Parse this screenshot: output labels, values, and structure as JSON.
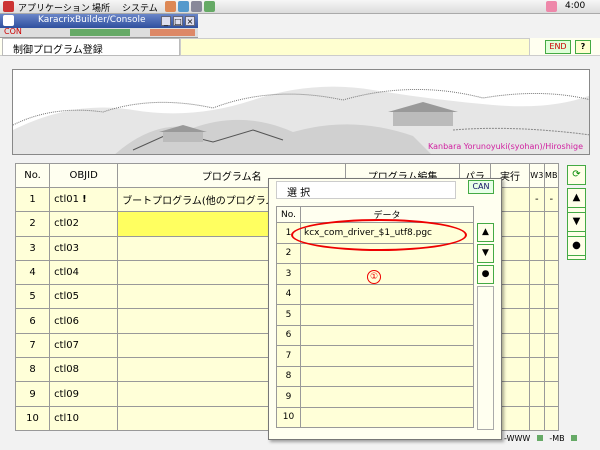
{
  "system_bar": {
    "menu_apps": "アプリケーション",
    "menu_places": "場所",
    "menu_system": "システム",
    "clock": "4:00"
  },
  "window": {
    "title": "KaracrixBuilder/Console",
    "minimize": "_",
    "maximize": "□",
    "close": "×",
    "tab_label": "CON"
  },
  "header": {
    "title": "制御プログラム登録",
    "end_label": "END",
    "help_label": "?"
  },
  "banner": {
    "credit": "Kanbara Yorunoyuki(syohan)/Hiroshige"
  },
  "main_table": {
    "headers": [
      "No.",
      "OBJID",
      "プログラム名",
      "プログラム編集",
      "パラ",
      "実行",
      "W3",
      "MB"
    ],
    "rows": [
      {
        "no": "1",
        "objid": "ctl01",
        "flag": "!",
        "name": "ブートプログラム(他のプログラム",
        "w3": "-",
        "mb": "-"
      },
      {
        "no": "2",
        "objid": "ctl02",
        "flag": "",
        "name": "",
        "w3": "",
        "mb": ""
      },
      {
        "no": "3",
        "objid": "ctl03",
        "flag": "",
        "name": "",
        "w3": "",
        "mb": ""
      },
      {
        "no": "4",
        "objid": "ctl04",
        "flag": "",
        "name": "",
        "w3": "",
        "mb": ""
      },
      {
        "no": "5",
        "objid": "ctl05",
        "flag": "",
        "name": "",
        "w3": "",
        "mb": ""
      },
      {
        "no": "6",
        "objid": "ctl06",
        "flag": "",
        "name": "",
        "w3": "",
        "mb": ""
      },
      {
        "no": "7",
        "objid": "ctl07",
        "flag": "",
        "name": "",
        "w3": "",
        "mb": ""
      },
      {
        "no": "8",
        "objid": "ctl08",
        "flag": "",
        "name": "",
        "w3": "",
        "mb": ""
      },
      {
        "no": "9",
        "objid": "ctl09",
        "flag": "",
        "name": "",
        "w3": "",
        "mb": ""
      },
      {
        "no": "10",
        "objid": "ctl10",
        "flag": "",
        "name": "",
        "w3": "",
        "mb": ""
      }
    ]
  },
  "side_buttons": {
    "refresh": "⟳",
    "up": "▲",
    "down": "▼",
    "dot": "●"
  },
  "popup": {
    "title": "選 択",
    "can_label": "CAN",
    "headers": [
      "No.",
      "データ"
    ],
    "rows": [
      {
        "no": "1",
        "data": "kcx_com_driver_$1_utf8.pgc"
      },
      {
        "no": "2",
        "data": ""
      },
      {
        "no": "3",
        "data": ""
      },
      {
        "no": "4",
        "data": ""
      },
      {
        "no": "5",
        "data": ""
      },
      {
        "no": "6",
        "data": ""
      },
      {
        "no": "7",
        "data": ""
      },
      {
        "no": "8",
        "data": ""
      },
      {
        "no": "9",
        "data": ""
      },
      {
        "no": "10",
        "data": ""
      }
    ],
    "nav_up": "▲",
    "nav_down": "▼",
    "nav_dot": "●"
  },
  "annotation": {
    "number": "①"
  },
  "status": {
    "left": "-WWW",
    "right": "-MB"
  },
  "colors": {
    "title_bar": "#2f4f9e",
    "row_bg": "#ffffd8",
    "selected_row": "#ffff60",
    "annotation": "#e00000",
    "button_border": "#44aa44"
  }
}
